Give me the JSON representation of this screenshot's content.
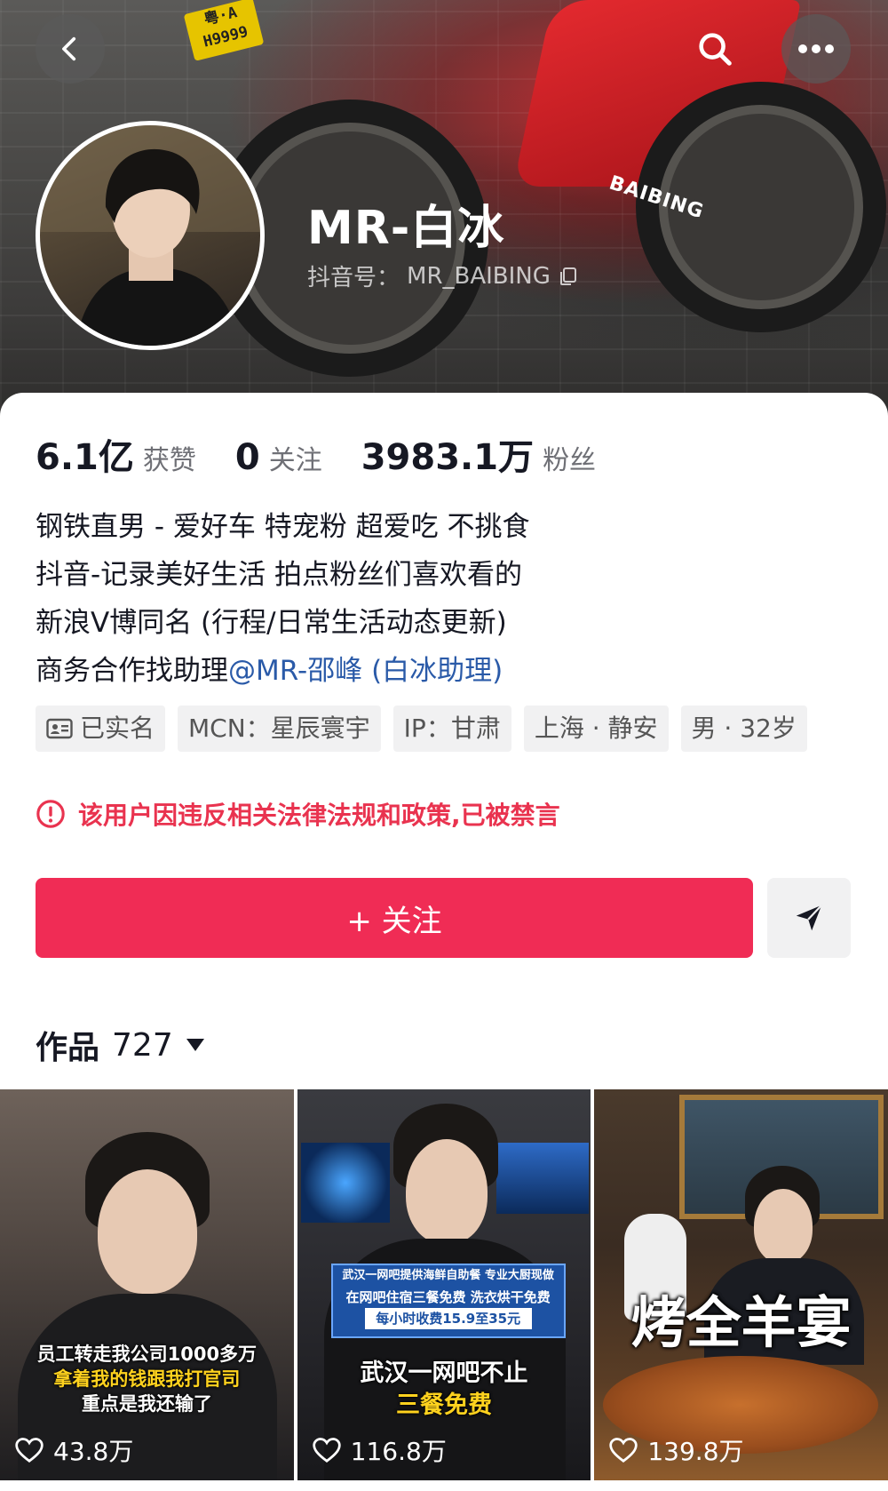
{
  "header": {
    "plate_text": [
      "粤·A",
      "H9999"
    ],
    "bike_brand": "BAIBING",
    "username": "MR-白冰",
    "handle_label": "抖音号：",
    "handle_value": "MR_BAIBING"
  },
  "stats": [
    {
      "value": "6.1亿",
      "label": "获赞"
    },
    {
      "value": "0",
      "label": "关注"
    },
    {
      "value": "3983.1万",
      "label": "粉丝"
    }
  ],
  "bio": {
    "lines": [
      "钢铁直男 - 爱好车 特宠粉 超爱吃 不挑食",
      "抖音-记录美好生活 拍点粉丝们喜欢看的",
      "新浪V博同名 (行程/日常生活动态更新)"
    ],
    "line4_prefix": "商务合作找助理",
    "line4_mention": "@MR-邵峰 (白冰助理)"
  },
  "tags": [
    "已实名",
    "MCN：星辰寰宇",
    "IP：甘肃",
    "上海 · 静安",
    "男 · 32岁"
  ],
  "warning": "该用户因违反相关法律法规和政策,已被禁言",
  "follow_button": "+ 关注",
  "works": {
    "label": "作品",
    "count": "727"
  },
  "videos": [
    {
      "caption_lines": [
        "员工转走我公司1000多万",
        "拿着我的钱跟我打官司",
        "重点是我还输了"
      ],
      "likes": "43.8万"
    },
    {
      "banner_lines": [
        "武汉一网吧提供海鲜自助餐 专业大厨现做",
        "在网吧住宿三餐免费 洗衣烘干免费",
        "每小时收费15.9至35元"
      ],
      "caption_lines": [
        "武汉一网吧不止",
        "三餐免费"
      ],
      "likes": "116.8万"
    },
    {
      "caption_lines": [
        "烤全羊宴"
      ],
      "likes": "139.8万"
    }
  ],
  "colors": {
    "accent": "#f02c55",
    "warning": "#e9334f",
    "mention": "#2a5aa8"
  }
}
